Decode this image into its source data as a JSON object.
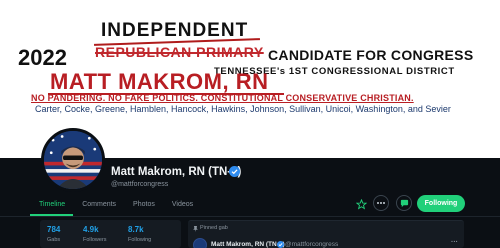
{
  "banner": {
    "independent": "INDEPENDENT",
    "year": "2022",
    "struck_text": "REPUBLICAN PRIMARY",
    "candidate_for": "CANDIDATE FOR CONGRESS",
    "district": "TENNESSEE's 1ST CONGRESSIONAL DISTRICT",
    "name": "MATT MAKROM, RN",
    "tagline": "NO PANDERING. NO FAKE POLITICS. CONSTITUTIONAL CONSERVATIVE CHRISTIAN.",
    "counties": "Carter, Cocke, Greene, Hamblen, Hancock, Hawkins, Johnson, Sullivan, Unicoi, Washington, and Sevier"
  },
  "profile": {
    "display_name": "Matt Makrom, RN (TN-1)",
    "handle": "@mattforcongress",
    "tabs": [
      {
        "label": "Timeline",
        "active": true
      },
      {
        "label": "Comments",
        "active": false
      },
      {
        "label": "Photos",
        "active": false
      },
      {
        "label": "Videos",
        "active": false
      }
    ],
    "actions": {
      "star_icon": "star-icon",
      "more_icon": "ellipsis-icon",
      "chat_icon": "chat-icon",
      "follow_label": "Following"
    },
    "stats": [
      {
        "value": "784",
        "label": "Gabs"
      },
      {
        "value": "4.9k",
        "label": "Followers"
      },
      {
        "value": "8.7k",
        "label": "Following"
      }
    ]
  },
  "pinned": {
    "label": "Pinned gab",
    "author": "Matt Makrom, RN (TN-1)",
    "handle": "@mattforcongress",
    "more": "···"
  },
  "colors": {
    "accent": "#21d07a",
    "stat_value": "#21a0e6",
    "banner_red": "#b81e23",
    "background": "#0b0f14"
  }
}
